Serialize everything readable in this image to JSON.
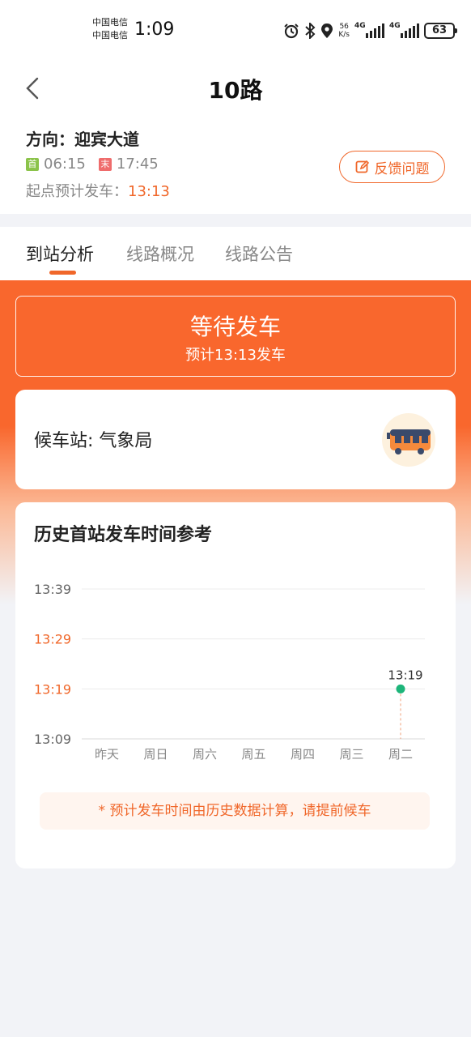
{
  "status_bar": {
    "carrier_1": "中国电信",
    "carrier_2": "中国电信",
    "time": "1:09",
    "net_speed_value": "56",
    "net_speed_unit": "K/s",
    "signal_1": "4G",
    "signal_2": "4G",
    "battery": "63"
  },
  "header": {
    "title": "10路",
    "direction": "方向：迎宾大道",
    "first_tag": "首",
    "first_time": "06:15",
    "last_tag": "末",
    "last_time": "17:45",
    "estimate_label": "起点预计发车：",
    "estimate_value": "13:13",
    "feedback_label": "反馈问题"
  },
  "tabs": [
    {
      "label": "到站分析",
      "active": true
    },
    {
      "label": "线路概况",
      "active": false
    },
    {
      "label": "线路公告",
      "active": false
    }
  ],
  "status": {
    "title": "等待发车",
    "subtitle": "预计13:13发车"
  },
  "stop": {
    "label": "候车站: 气象局"
  },
  "history": {
    "title": "历史首站发车时间参考",
    "note": "* 预计发车时间由历史数据计算，请提前候车"
  },
  "chart_data": {
    "type": "scatter",
    "title": "历史首站发车时间参考",
    "categories": [
      "昨天",
      "周日",
      "周六",
      "周五",
      "周四",
      "周三",
      "周二"
    ],
    "y_ticks": [
      "13:09",
      "13:19",
      "13:29",
      "13:39"
    ],
    "highlight_ticks": [
      "13:19",
      "13:29"
    ],
    "ylim_minutes": [
      549,
      579
    ],
    "points": [
      {
        "category": "周二",
        "label": "13:19",
        "minutes": 559
      }
    ],
    "grid": true,
    "colors": {
      "point": "#1db57a",
      "tick_highlight": "#f0672a",
      "tick_normal": "#666666"
    }
  },
  "colors": {
    "accent": "#f0672a",
    "orange_bg": "#f9672d"
  }
}
